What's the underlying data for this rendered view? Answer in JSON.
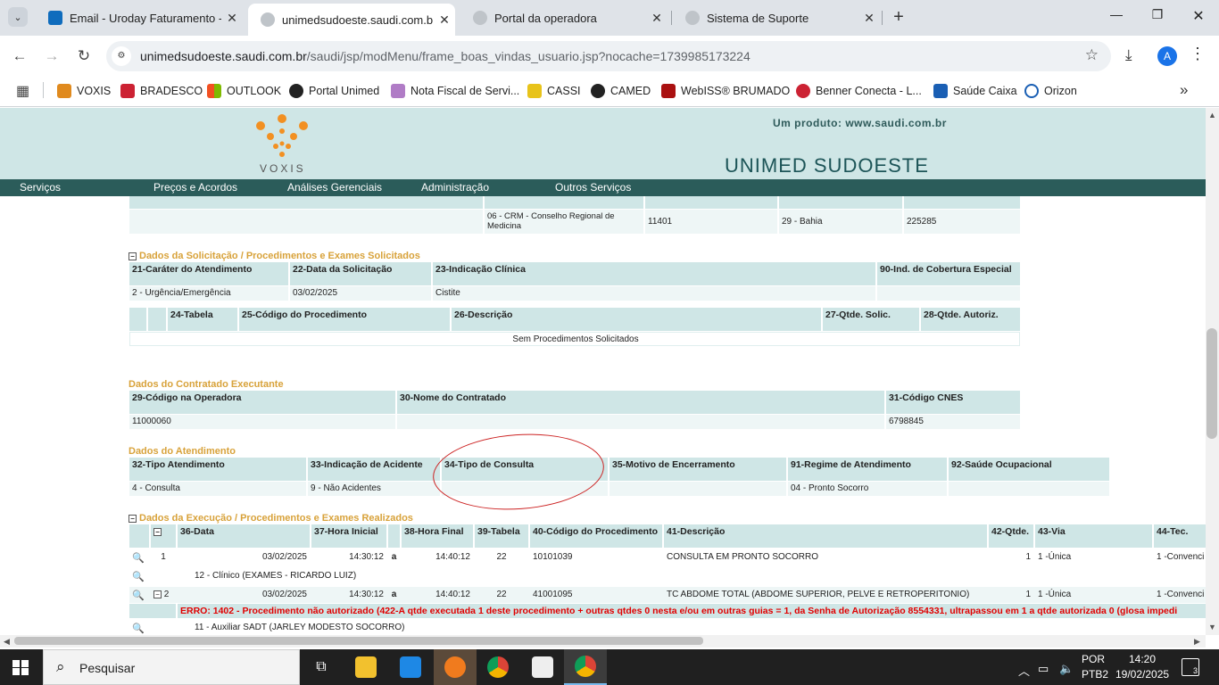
{
  "browser": {
    "tabs": [
      {
        "label": "Email - Uroday Faturamento - O",
        "icon_color": "#0f6cbd",
        "active": false
      },
      {
        "label": "unimedsudoeste.saudi.com.br/s",
        "icon_color": "#5f6368",
        "active": true
      },
      {
        "label": "Portal da operadora",
        "icon_color": "#5f6368",
        "active": false
      },
      {
        "label": "Sistema de Suporte",
        "icon_color": "#5f6368",
        "active": false
      }
    ],
    "new_tab": "+",
    "url_domain": "unimedsudoeste.saudi.com.br",
    "url_path": "/saudi/jsp/modMenu/frame_boas_vindas_usuario.jsp?nocache=1739985173224",
    "avatar_letter": "A",
    "bookmarks": [
      {
        "label": "VOXIS",
        "color": "#e08a1e"
      },
      {
        "label": "BRADESCO",
        "color": "#cc2233"
      },
      {
        "label": "OUTLOOK",
        "color": "#f25022"
      },
      {
        "label": "Portal Unimed",
        "color": "#222222"
      },
      {
        "label": "Nota Fiscal de Servi...",
        "color": "#b07cc6"
      },
      {
        "label": "CASSI",
        "color": "#e8c31a"
      },
      {
        "label": "CAMED",
        "color": "#222222"
      },
      {
        "label": "WebISS® BRUMADO",
        "color": "#aa1111"
      },
      {
        "label": "Benner Conecta - L...",
        "color": "#cc2233"
      },
      {
        "label": "Saúde Caixa",
        "color": "#1a5fb4"
      },
      {
        "label": "Orizon",
        "color": "#1a5fb4"
      }
    ]
  },
  "header": {
    "logo_text": "VOXIS",
    "produto": "Um produto: www.saudi.com.br",
    "operadora": "UNIMED SUDOESTE"
  },
  "menu": [
    "Serviços",
    "Preços e Acordos",
    "Análises Gerenciais",
    "Administração",
    "Outros Serviços"
  ],
  "profissional_row": {
    "conselho": "06 - CRM - Conselho Regional de Medicina",
    "numero": "11401",
    "uf": "29 - Bahia",
    "cbo": "225285"
  },
  "solicitacao": {
    "title": "Dados da Solicitação / Procedimentos e Exames Solicitados",
    "headers": [
      "21-Caráter do Atendimento",
      "22-Data da Solicitação",
      "23-Indicação Clínica",
      "90-Ind. de Cobertura Especial"
    ],
    "values": [
      "2 - Urgência/Emergência",
      "03/02/2025",
      "Cistite",
      ""
    ],
    "proc_headers": [
      "",
      "",
      "24-Tabela",
      "25-Código do Procedimento",
      "26-Descrição",
      "27-Qtde. Solic.",
      "28-Qtde. Autoriz."
    ],
    "empty_msg": "Sem Procedimentos Solicitados"
  },
  "contratado": {
    "title": "Dados do Contratado Executante",
    "headers": [
      "29-Código na Operadora",
      "30-Nome do Contratado",
      "31-Código CNES"
    ],
    "values": [
      "11000060",
      "",
      "6798845"
    ]
  },
  "atendimento": {
    "title": "Dados do Atendimento",
    "headers": [
      "32-Tipo Atendimento",
      "33-Indicação de Acidente",
      "34-Tipo de Consulta",
      "35-Motivo de Encerramento",
      "91-Regime de Atendimento",
      "92-Saúde Ocupacional"
    ],
    "values": [
      "4 - Consulta",
      "9 - Não Acidentes",
      "",
      "",
      "04 - Pronto Socorro",
      ""
    ]
  },
  "execucao": {
    "title": "Dados da Execução / Procedimentos e Exames Realizados",
    "headers": [
      "",
      "",
      "36-Data",
      "37-Hora Inicial",
      "",
      "38-Hora Final",
      "39-Tabela",
      "40-Código do Procedimento",
      "41-Descrição",
      "42-Qtde.",
      "43-Via",
      "44-Tec."
    ],
    "rows": [
      {
        "num": "1",
        "data": "03/02/2025",
        "hora_ini": "14:30:12",
        "a": "a",
        "hora_fim": "14:40:12",
        "tabela": "22",
        "codigo": "10101039",
        "descricao": "CONSULTA EM PRONTO SOCORRO",
        "qtde": "1",
        "via": "1 -Única",
        "tec": "1 -Convenci",
        "equipe": "12 - Clínico  (EXAMES - RICARDO LUIZ)"
      },
      {
        "num": "2",
        "data": "03/02/2025",
        "hora_ini": "14:30:12",
        "a": "a",
        "hora_fim": "14:40:12",
        "tabela": "22",
        "codigo": "41001095",
        "descricao": "TC ABDOME TOTAL (ABDOME SUPERIOR, PELVE E RETROPERITONIO)",
        "qtde": "1",
        "via": "1 -Única",
        "tec": "1 -Convenci",
        "equipe": "11 - Auxiliar SADT  (JARLEY MODESTO SOCORRO)"
      }
    ],
    "error": "ERRO: 1402 - Procedimento não autorizado (422-A qtde executada 1 deste procedimento + outras qtdes 0 nesta e/ou em outras guias = 1, da Senha de Autorização 8554331, ultrapassou em 1 a qtde autorizada 0 (glosa impedi"
  },
  "taskbar": {
    "search_placeholder": "Pesquisar",
    "lang_line1": "POR",
    "lang_line2": "PTB2",
    "time": "14:20",
    "date": "19/02/2025",
    "notifications": "3"
  }
}
